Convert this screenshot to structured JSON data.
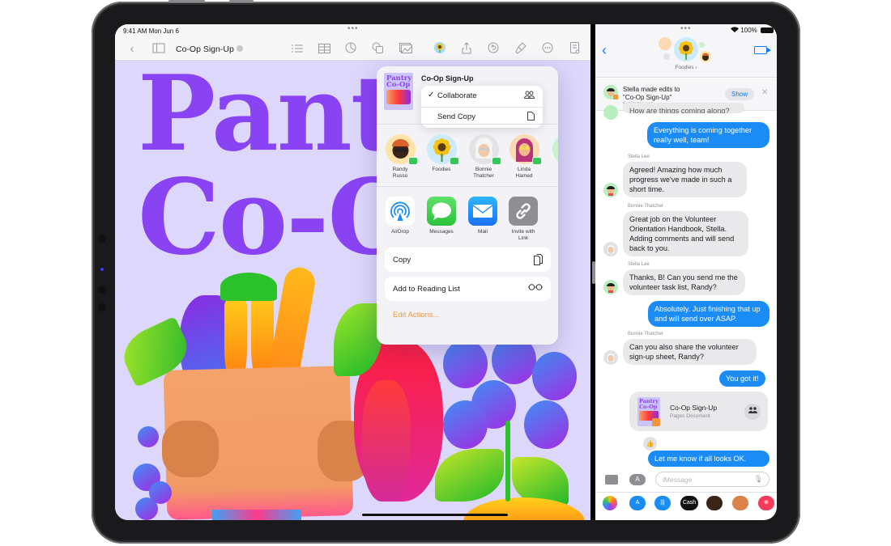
{
  "pages": {
    "status_time": "9:41 AM   Mon Jun 6",
    "multitask_dots": "•••",
    "toolbar": {
      "back_icon": "chevron-left-icon",
      "sidebar_icon": "sidebar-icon",
      "title": "Co-Op Sign-Up",
      "icons": [
        "list-icon",
        "table-icon",
        "chart-icon",
        "shapes-icon",
        "media-icon",
        "collaborator-avatar",
        "share-icon",
        "undo-icon",
        "format-brush-icon",
        "more-icon",
        "document-view-icon"
      ]
    },
    "canvas": {
      "headline_line1": "Pantry",
      "headline_line2": "Co-Op",
      "colors": {
        "background": "#ddd8fb",
        "headline": "#8a43f3"
      }
    }
  },
  "share_sheet": {
    "document_title": "Co-Op Sign-Up",
    "thumb_text": "Pantry Co-Op",
    "mode_menu": [
      {
        "label": "Collaborate",
        "checked": true,
        "icon": "people-icon"
      },
      {
        "label": "Send Copy",
        "checked": false,
        "icon": "document-icon"
      }
    ],
    "people": [
      {
        "name_line1": "Randy",
        "name_line2": "Russo",
        "color": "#fde3a7"
      },
      {
        "name_line1": "Foodies",
        "name_line2": "",
        "color": "#cdeafc"
      },
      {
        "name_line1": "Bonnie",
        "name_line2": "Thatcher",
        "color": "#e3e3e6"
      },
      {
        "name_line1": "Linda",
        "name_line2": "Hamed",
        "color": "#fcd9b4"
      }
    ],
    "apps": [
      {
        "name_line1": "AirDrop",
        "name_line2": "",
        "icon": "airdrop-icon"
      },
      {
        "name_line1": "Messages",
        "name_line2": "",
        "icon": "messages-icon"
      },
      {
        "name_line1": "Mail",
        "name_line2": "",
        "icon": "mail-icon"
      },
      {
        "name_line1": "Invite with",
        "name_line2": "Link",
        "icon": "link-icon"
      }
    ],
    "actions": [
      {
        "label": "Copy",
        "icon": "⧉"
      },
      {
        "label": "Add to Reading List",
        "icon": "○○"
      }
    ],
    "edit_actions": "Edit Actions...",
    "accent": "#f0963c"
  },
  "messages": {
    "status": {
      "dots": "•••",
      "battery": "100%"
    },
    "group_name": "Foodies ›",
    "notice": {
      "line1": "Stella made edits to",
      "line2": "\"Co-Op Sign-Up\"",
      "time": "5 minutes ago",
      "show_label": "Show",
      "close_icon": "✕"
    },
    "thread": [
      {
        "dir": "out",
        "text": "Everything is coming together really well, team!"
      },
      {
        "dir": "in",
        "sender": "Stella Lee",
        "text": "Agreed! Amazing how much progress we've made in such a short time."
      },
      {
        "dir": "in",
        "sender": "Bonnie Thatcher",
        "text": "Great job on the Volunteer Orientation Handbook, Stella. Adding comments and will send back to you."
      },
      {
        "dir": "in",
        "sender": "Stella Lee",
        "text": "Thanks, B! Can you send me the volunteer task list, Randy?"
      },
      {
        "dir": "out",
        "text": "Absolutely. Just finishing that up and will send over ASAP."
      },
      {
        "dir": "in",
        "sender": "Bonnie Thatcher",
        "text": "Can you also share the volunteer sign-up sheet, Randy?"
      },
      {
        "dir": "out",
        "text": "You got it!"
      },
      {
        "dir": "out",
        "text": "Let me know if all looks OK."
      }
    ],
    "partial_top_text": "How are things coming along?",
    "attachment": {
      "title": "Co-Op Sign-Up",
      "subtitle": "Pages Document",
      "thumb_text": "Pantry Co-Op"
    },
    "tapback": "👍",
    "compose": {
      "placeholder": "iMessage",
      "mic_icon": "🎙"
    },
    "app_strip": [
      "Photos",
      "App Store",
      "Audio",
      "Cash",
      "Memoji",
      "Memoji Stickers",
      "Search"
    ],
    "colors": {
      "outgoing": "#1b8cf5",
      "incoming": "#e9e9eb",
      "accent": "#0a7aff"
    }
  }
}
